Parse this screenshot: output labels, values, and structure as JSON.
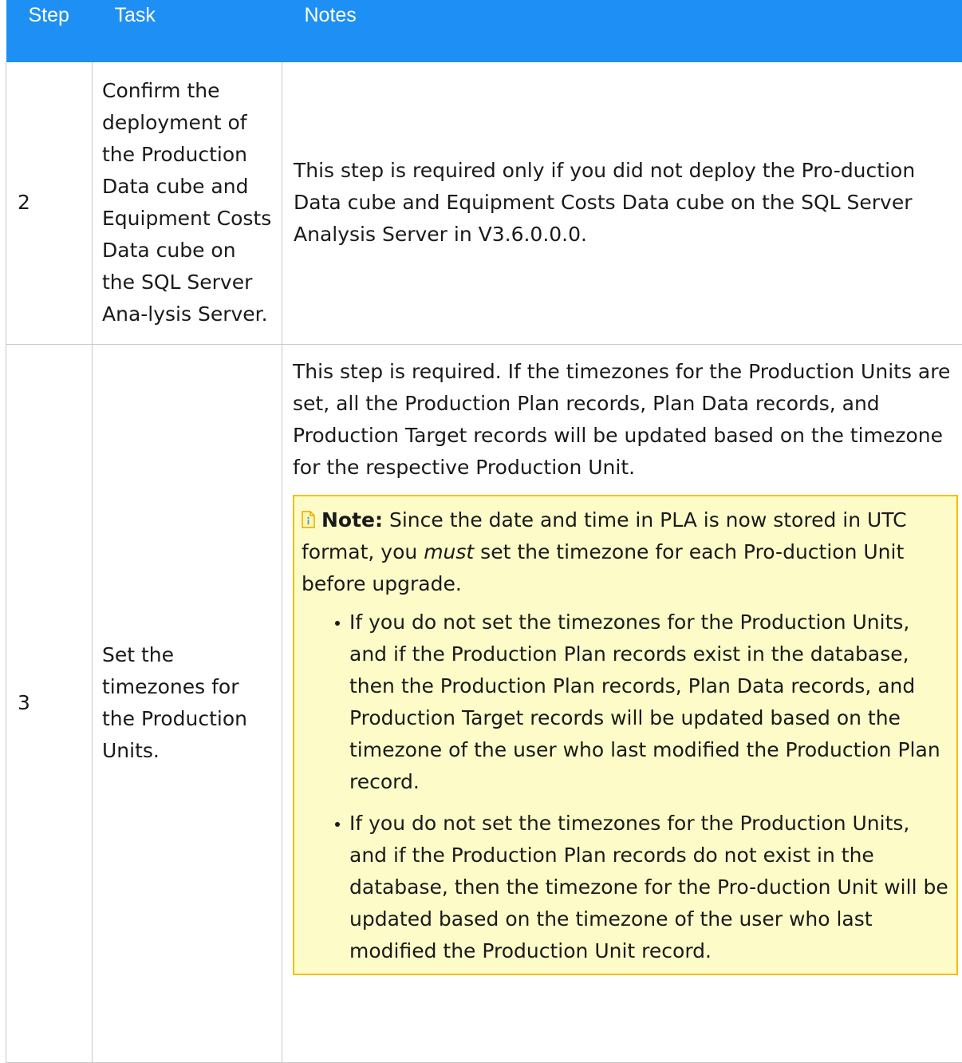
{
  "table": {
    "headers": {
      "step": "Step",
      "task": "Task",
      "notes": "Notes"
    },
    "rows": [
      {
        "step": "2",
        "task": "Confirm the deployment of the Production Data cube and Equipment Costs Data cube on the SQL Server Ana-lysis Server.",
        "notes": "This step is required only if you did not deploy the Pro-duction Data cube and Equipment Costs Data cube on the SQL Server Analysis Server in V3.6.0.0.0."
      },
      {
        "step": "3",
        "task": "Set the timezones for the Production Units.",
        "notes": "This step is required. If the timezones for the Production Units are set, all the Production Plan records, Plan Data records, and Production Target records will be updated based on the timezone for the respective Production Unit.",
        "note": {
          "icon": "note-info-icon",
          "label": "Note:",
          "text_before": " Since the date and time in PLA is now stored in UTC format, you ",
          "emphasis": "must",
          "text_after": " set the timezone for each Pro-duction Unit before upgrade.",
          "bullets": [
            "If you do not set the timezones for the Production Units, and if the Production Plan records exist in the database, then the Production Plan records, Plan Data records, and Production Target records will be updated based on the timezone of the user who last modified the Production Plan record.",
            "If you do not set the timezones for the Production Units, and if the Production Plan records do not exist in the database, then the timezone for the Pro-duction Unit will be updated based on the timezone of the user who last modified the Production Unit record."
          ]
        }
      }
    ]
  },
  "colors": {
    "header_bg": "#1e90f5",
    "header_text": "#ffffff",
    "note_bg": "#fdfcc8",
    "note_border": "#f2c000",
    "cell_border": "#c9c9c9"
  }
}
